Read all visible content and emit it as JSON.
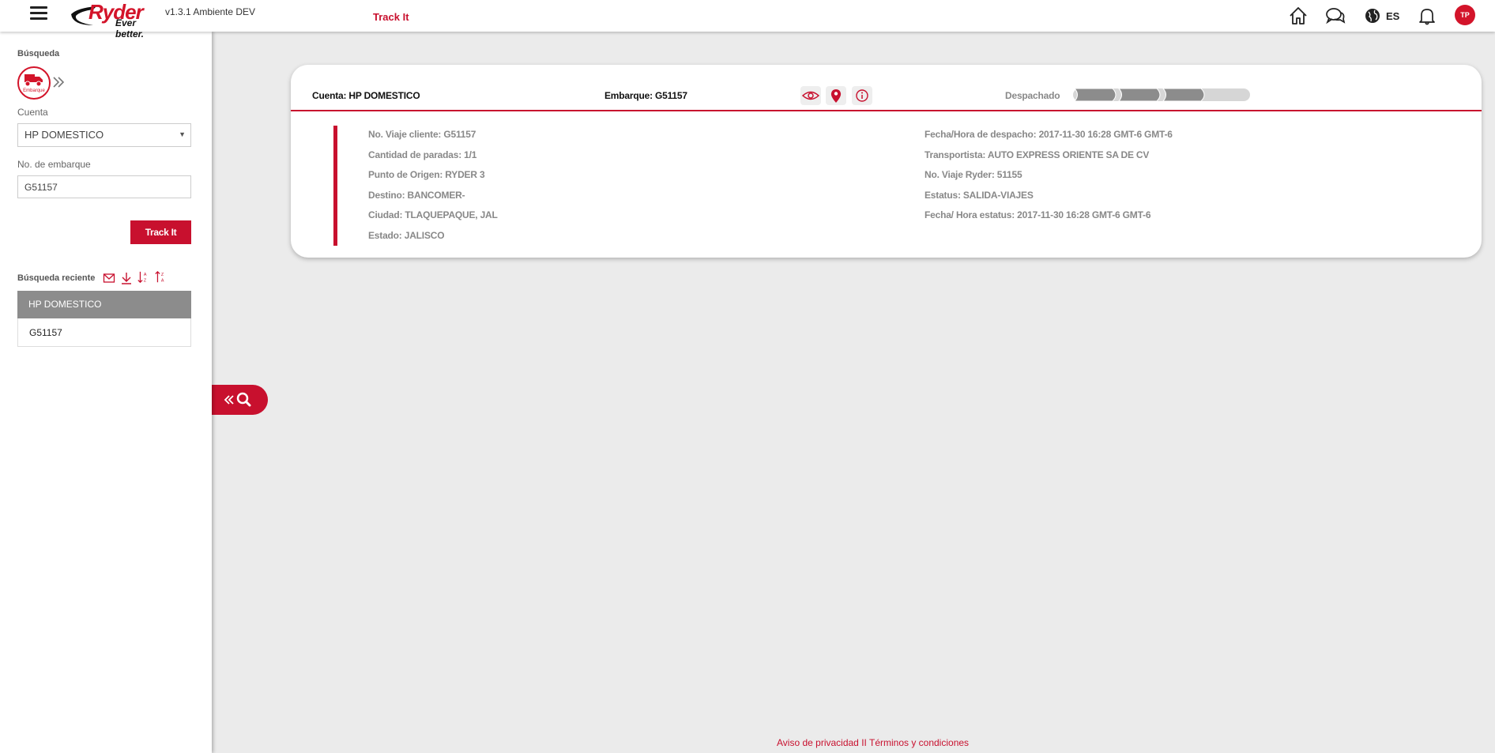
{
  "header": {
    "brand": "Ryder",
    "tagline": "Ever better.",
    "version": "v1.3.1 Ambiente DEV",
    "title": "Track It",
    "language": "ES",
    "user_initials": "TP",
    "icons": [
      "menu-icon",
      "home-icon",
      "chat-icon",
      "globe-icon",
      "bell-icon"
    ],
    "accent_color": "#c8102e"
  },
  "sidebar": {
    "search_label": "Búsqueda",
    "shipment_button_caption": "Embarque",
    "account_label": "Cuenta",
    "account_value": "HP DOMESTICO",
    "shipment_label": "No. de embarque",
    "shipment_value": "G51157",
    "track_button": "Track It",
    "recent_label": "Búsqueda reciente",
    "recent_icons": [
      "mail-icon",
      "download-icon",
      "sort-az-icon",
      "sort-za-icon"
    ],
    "recent_group": "HP DOMESTICO",
    "recent_items": [
      "G51157"
    ]
  },
  "card": {
    "account": "Cuenta: HP DOMESTICO",
    "shipment": "Embarque: G51157",
    "status": "Despachado",
    "progress_steps_completed": 3,
    "progress_steps_total": 4,
    "left_fields": [
      "No. Viaje cliente: G51157",
      "Cantidad de paradas: 1/1",
      "Punto de Origen: RYDER 3",
      "Destino: BANCOMER-",
      "Ciudad: TLAQUEPAQUE, JAL",
      "Estado: JALISCO"
    ],
    "right_fields": [
      "Fecha/Hora de despacho: 2017-11-30 16:28 GMT-6 GMT-6",
      "Transportista: AUTO EXPRESS ORIENTE SA DE CV",
      "No. Viaje Ryder: 51155",
      "Estatus: SALIDA-VIAJES",
      "Fecha/ Hora estatus: 2017-11-30 16:28 GMT-6 GMT-6"
    ]
  },
  "footer": {
    "privacy": "Aviso de privacidad",
    "separator": "II",
    "terms": "Términos y condiciones"
  }
}
